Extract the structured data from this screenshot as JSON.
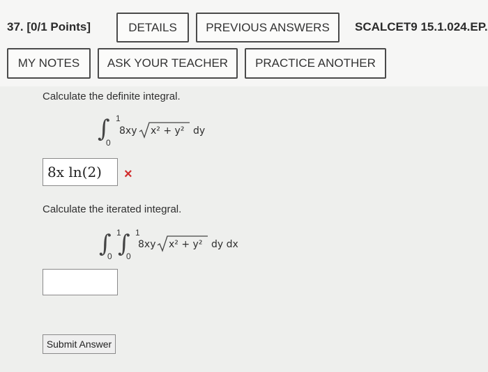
{
  "header": {
    "question": "37. [0/1 Points]",
    "details": "DETAILS",
    "previous": "PREVIOUS ANSWERS",
    "code": "SCALCET9 15.1.024.EP.",
    "my_notes": "MY NOTES",
    "ask_teacher": "ASK YOUR TEACHER",
    "practice": "PRACTICE ANOTHER"
  },
  "part1": {
    "prompt": "Calculate the definite integral.",
    "upper": "1",
    "lower": "0",
    "integrand": "8xy",
    "radicand": "x² + y²",
    "differential": "dy",
    "answer": "8x ln(2)",
    "status": "×"
  },
  "part2": {
    "prompt": "Calculate the iterated integral.",
    "outer_upper": "1",
    "outer_lower": "0",
    "inner_upper": "1",
    "inner_lower": "0",
    "integrand": "8xy",
    "radicand": "x² + y²",
    "differential": "dy dx",
    "answer": ""
  },
  "submit_label": "Submit Answer",
  "colors": {
    "incorrect": "#d12d2d",
    "button_border": "#4a4a4a"
  }
}
